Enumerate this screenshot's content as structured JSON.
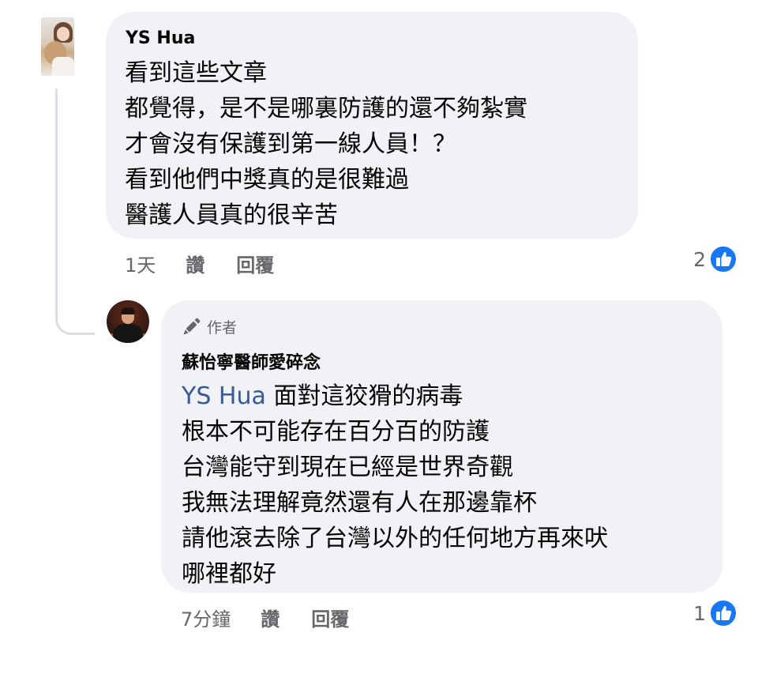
{
  "comments": [
    {
      "author": "YS Hua",
      "lines": [
        "看到這些文章",
        "都覺得，是不是哪裏防護的還不夠紮實",
        "才會沒有保護到第一線人員！？",
        "看到他們中獎真的是很難過",
        "醫護人員真的很辛苦"
      ],
      "time": "1天",
      "like_label": "讚",
      "reply_label": "回覆",
      "reaction_count": "2",
      "reaction_icon": "like-icon"
    },
    {
      "badge": "作者",
      "badge_icon": "pencil-icon",
      "author": "蘇怡寧醫師愛碎念",
      "mention": "YS Hua",
      "first_line_rest": " 面對這狡猾的病毒",
      "lines": [
        "根本不可能存在百分百的防護",
        "台灣能守到現在已經是世界奇觀",
        "我無法理解竟然還有人在那邊靠杯",
        "請他滾去除了台灣以外的任何地方再來吠",
        "哪裡都好"
      ],
      "time": "7分鐘",
      "like_label": "讚",
      "reply_label": "回覆",
      "reaction_count": "1",
      "reaction_icon": "like-icon"
    }
  ],
  "colors": {
    "bubble": "#f0f2f5",
    "mention": "#385898",
    "like_blue": "#1877f2",
    "meta_gray": "#65676b"
  }
}
